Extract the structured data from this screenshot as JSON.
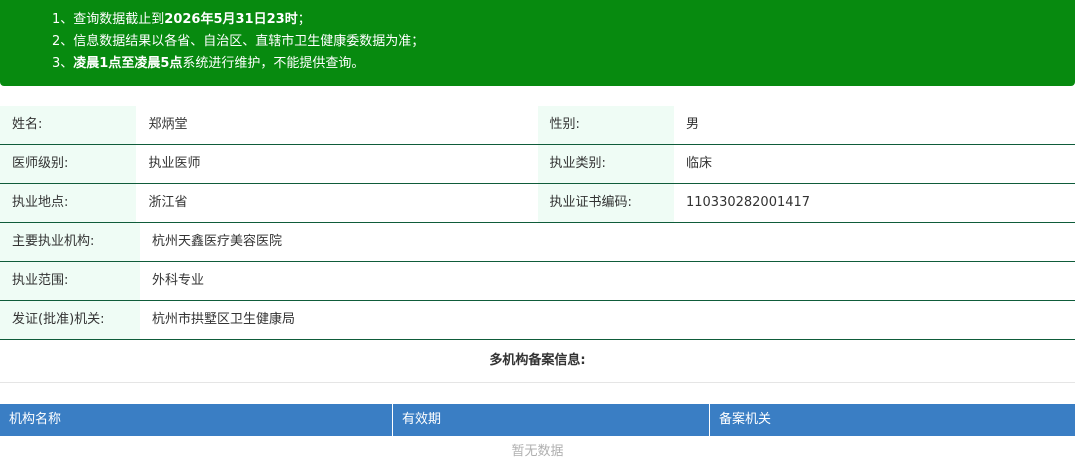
{
  "notice": {
    "line1_prefix": "1、查询数据截止到",
    "line1_bold": "2026年5月31日23时",
    "line1_suffix": "；",
    "line2": "2、信息数据结果以各省、自治区、直辖市卫生健康委数据为准；",
    "line3_prefix": "3、",
    "line3_bold": "凌晨1点至凌晨5点",
    "line3_suffix": "系统进行维护，不能提供查询。"
  },
  "info": {
    "name_label": "姓名:",
    "name_value": "郑炳堂",
    "gender_label": "性别:",
    "gender_value": "男",
    "level_label": "医师级别:",
    "level_value": "执业医师",
    "category_label": "执业类别:",
    "category_value": "临床",
    "location_label": "执业地点:",
    "location_value": "浙江省",
    "cert_label": "执业证书编码:",
    "cert_value": "110330282001417",
    "institution_label": "主要执业机构:",
    "institution_value": "杭州天鑫医疗美容医院",
    "scope_label": "执业范围:",
    "scope_value": "外科专业",
    "authority_label": "发证(批准)机关:",
    "authority_value": "杭州市拱墅区卫生健康局"
  },
  "multi": {
    "title": "多机构备案信息:",
    "columns": [
      "机构名称",
      "有效期",
      "备案机关"
    ],
    "empty_text": "暂无数据"
  },
  "colors": {
    "notice_bg": "#078a0f",
    "label_bg": "#effcf5",
    "row_border": "#0f5c3a",
    "table_header_bg": "#3a7ec4"
  }
}
